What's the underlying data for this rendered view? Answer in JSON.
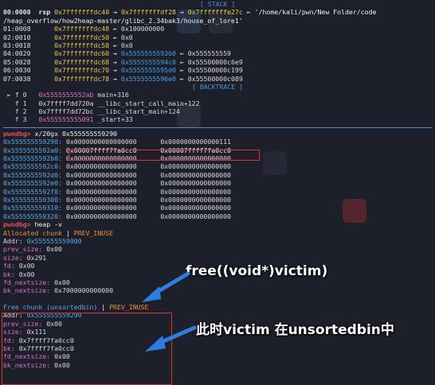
{
  "stack": {
    "header": "[ STACK ]",
    "rows": [
      {
        "idx": "00:0000",
        "reg": "rsp",
        "addr": "0x7fffffffdc40",
        "chain": "0x7fffffffdf28",
        "chain2": "0x7fffffffe27c",
        "tail": "'/home/kali/pwn/New Folder/code"
      },
      {
        "idx": "",
        "reg": "",
        "addr": "",
        "chain": "",
        "chain2": "",
        "tail": "/heap_overflow/how2heap-master/glibc_2.34bak3/house_of_lore1'"
      },
      {
        "idx": "01:0008",
        "reg": "",
        "addr": "0x7fffffffdc48",
        "chain": "",
        "chain2": "",
        "tail": "0x100000000"
      },
      {
        "idx": "02:0010",
        "reg": "",
        "addr": "0x7fffffffdc50",
        "chain": "",
        "chain2": "",
        "tail": "0x0"
      },
      {
        "idx": "03:0018",
        "reg": "",
        "addr": "0x7fffffffdc58",
        "chain": "",
        "chain2": "",
        "tail": "0x0"
      },
      {
        "idx": "04:0020",
        "reg": "",
        "addr": "0x7fffffffdc60",
        "chain": "0x5555555593b0",
        "chain2": "",
        "tail": "0x555555559"
      },
      {
        "idx": "05:0028",
        "reg": "",
        "addr": "0x7fffffffdc68",
        "chain": "0x5555555594c0",
        "chain2": "",
        "tail": "0x55500000c6e9"
      },
      {
        "idx": "06:0030",
        "reg": "",
        "addr": "0x7fffffffdc70",
        "chain": "0x5555555595d0",
        "chain2": "",
        "tail": "0x55500000c199"
      },
      {
        "idx": "07:0038",
        "reg": "",
        "addr": "0x7fffffffdc78",
        "chain": "0x5555555596e0",
        "chain2": "",
        "tail": "0x55500000c089"
      }
    ]
  },
  "backtrace": {
    "header": "[ BACKTRACE ]",
    "rows": [
      {
        "mark": "►",
        "frame": "f 0",
        "addr": "0x5555555552ab",
        "sym": "main+316"
      },
      {
        "mark": "",
        "frame": "f 1",
        "addr": "0x7ffff7dd720a",
        "sym": "__libc_start_call_main+122"
      },
      {
        "mark": "",
        "frame": "f 2",
        "addr": "0x7ffff7dd72bc",
        "sym": "__libc_start_main+124"
      },
      {
        "mark": "",
        "frame": "f 3",
        "addr": "0x555555555091",
        "sym": "_start+33"
      }
    ]
  },
  "x_cmd": {
    "prompt": "pwndbg>",
    "command": "x/20gx 0x555555559290",
    "rows": [
      {
        "addr": "0x555555559290:",
        "v1": "0x0000000000000000",
        "v2": "0x0000000000000111"
      },
      {
        "addr": "0x5555555592a0:",
        "v1": "0x00007ffff7fa0cc0",
        "v2": "0x00007ffff7fa0cc0"
      },
      {
        "addr": "0x5555555592b0:",
        "v1": "0x0000000000000000",
        "v2": "0x0000000000000000"
      },
      {
        "addr": "0x5555555592c0:",
        "v1": "0x0000000000000000",
        "v2": "0x0000000000000000"
      },
      {
        "addr": "0x5555555592d0:",
        "v1": "0x0000000000000000",
        "v2": "0x0000000000000000"
      },
      {
        "addr": "0x5555555592e0:",
        "v1": "0x0000000000000000",
        "v2": "0x0000000000000000"
      },
      {
        "addr": "0x5555555592f0:",
        "v1": "0x0000000000000000",
        "v2": "0x0000000000000000"
      },
      {
        "addr": "0x555555559300:",
        "v1": "0x0000000000000000",
        "v2": "0x0000000000000000"
      },
      {
        "addr": "0x555555559310:",
        "v1": "0x0000000000000000",
        "v2": "0x0000000000000000"
      },
      {
        "addr": "0x555555559320:",
        "v1": "0x0000000000000000",
        "v2": "0x0000000000000000"
      }
    ]
  },
  "heap_cmd": {
    "prompt": "pwndbg>",
    "command": "heap -v",
    "allocated": {
      "title": "Allocated chunk",
      "flag": "PREV_INUSE",
      "addr_label": "Addr:",
      "addr": "0x555555559000",
      "fields": [
        {
          "k": "prev_size:",
          "v": "0x00"
        },
        {
          "k": "size:",
          "v": "0x291"
        },
        {
          "k": "fd:",
          "v": "0x00"
        },
        {
          "k": "bk:",
          "v": "0x00"
        },
        {
          "k": "fd_nextsize:",
          "v": "0x00"
        },
        {
          "k": "bk_nextsize:",
          "v": "0x7000000000000"
        }
      ]
    },
    "free": {
      "title": "Free chunk (unsortedbin)",
      "flag": "PREV_INUSE",
      "addr_label": "Addr:",
      "addr": "0x555555559290",
      "fields": [
        {
          "k": "prev_size:",
          "v": "0x00"
        },
        {
          "k": "size:",
          "v": "0x111"
        },
        {
          "k": "fd:",
          "v": "0x7ffff7fa0cc0"
        },
        {
          "k": "bk:",
          "v": "0x7ffff7fa0cc0"
        },
        {
          "k": "fd_nextsize:",
          "v": "0x00"
        },
        {
          "k": "bk_nextsize:",
          "v": "0x00"
        }
      ]
    }
  },
  "annotations": {
    "free_call": "free((void*)victim)",
    "unsorted_note": "此时victim 在unsortedbin中"
  },
  "colors": {
    "background": "#1d1f2b",
    "separator": "#4f8fd6",
    "highlight_box": "#e03030",
    "arrow": "#2f7de0"
  }
}
